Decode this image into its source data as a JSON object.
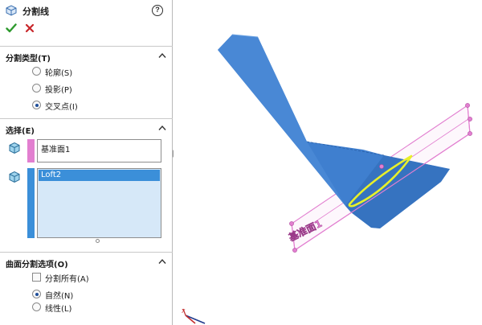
{
  "panel": {
    "title": "分割线",
    "help_label": "?",
    "split_type": {
      "title": "分割类型(T)",
      "options": [
        {
          "label": "轮廓(S)",
          "selected": false
        },
        {
          "label": "投影(P)",
          "selected": false
        },
        {
          "label": "交叉点(I)",
          "selected": true
        }
      ]
    },
    "selection": {
      "title": "选择(E)",
      "plane_field": "基准面1",
      "body_list": [
        "Loft2"
      ]
    },
    "surface_options": {
      "title": "曲面分割选项(O)",
      "split_all": {
        "label": "分割所有(A)",
        "checked": false
      },
      "options": [
        {
          "label": "自然(N)",
          "selected": true
        },
        {
          "label": "线性(L)",
          "selected": false
        }
      ]
    }
  },
  "viewport": {
    "plane_label": "基准面1",
    "triad_x_label": "X"
  },
  "colors": {
    "body_blue": "#3f7fcf",
    "plane_pink": "#e27fd0",
    "split_line_yellow": "#e8f02a",
    "selection_blue": "#3b8fd9",
    "accept_green": "#2e9a2e",
    "cancel_red": "#c8262a"
  }
}
